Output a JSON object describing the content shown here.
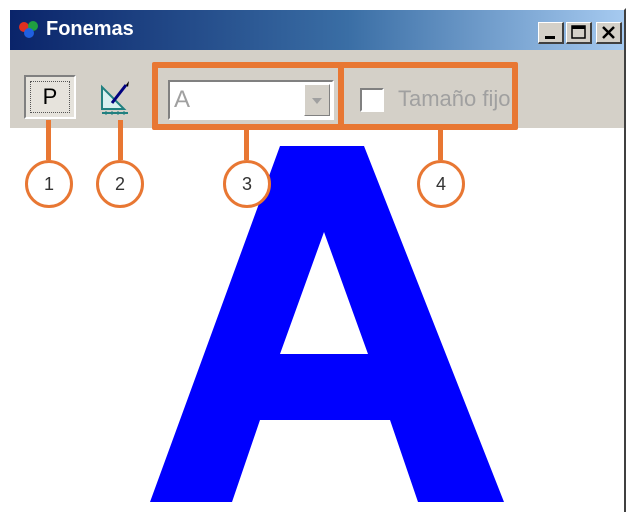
{
  "window": {
    "title": "Fonemas",
    "controls": {
      "minimize": "minimize-icon",
      "maximize": "maximize-icon",
      "close": "close-icon"
    }
  },
  "toolbar": {
    "p_button_label": "P",
    "draw_button_icon": "draw-tool-icon",
    "letter_select": {
      "value": "A"
    },
    "fixed_size_checkbox": {
      "label": "Tamaño fijo",
      "checked": false
    }
  },
  "canvas": {
    "letter": "A",
    "letter_color": "#0000ff"
  },
  "callouts": [
    "1",
    "2",
    "3",
    "4"
  ],
  "colors": {
    "accent": "#e87733",
    "titlebar_start": "#0a246a",
    "titlebar_end": "#a6caf0"
  }
}
